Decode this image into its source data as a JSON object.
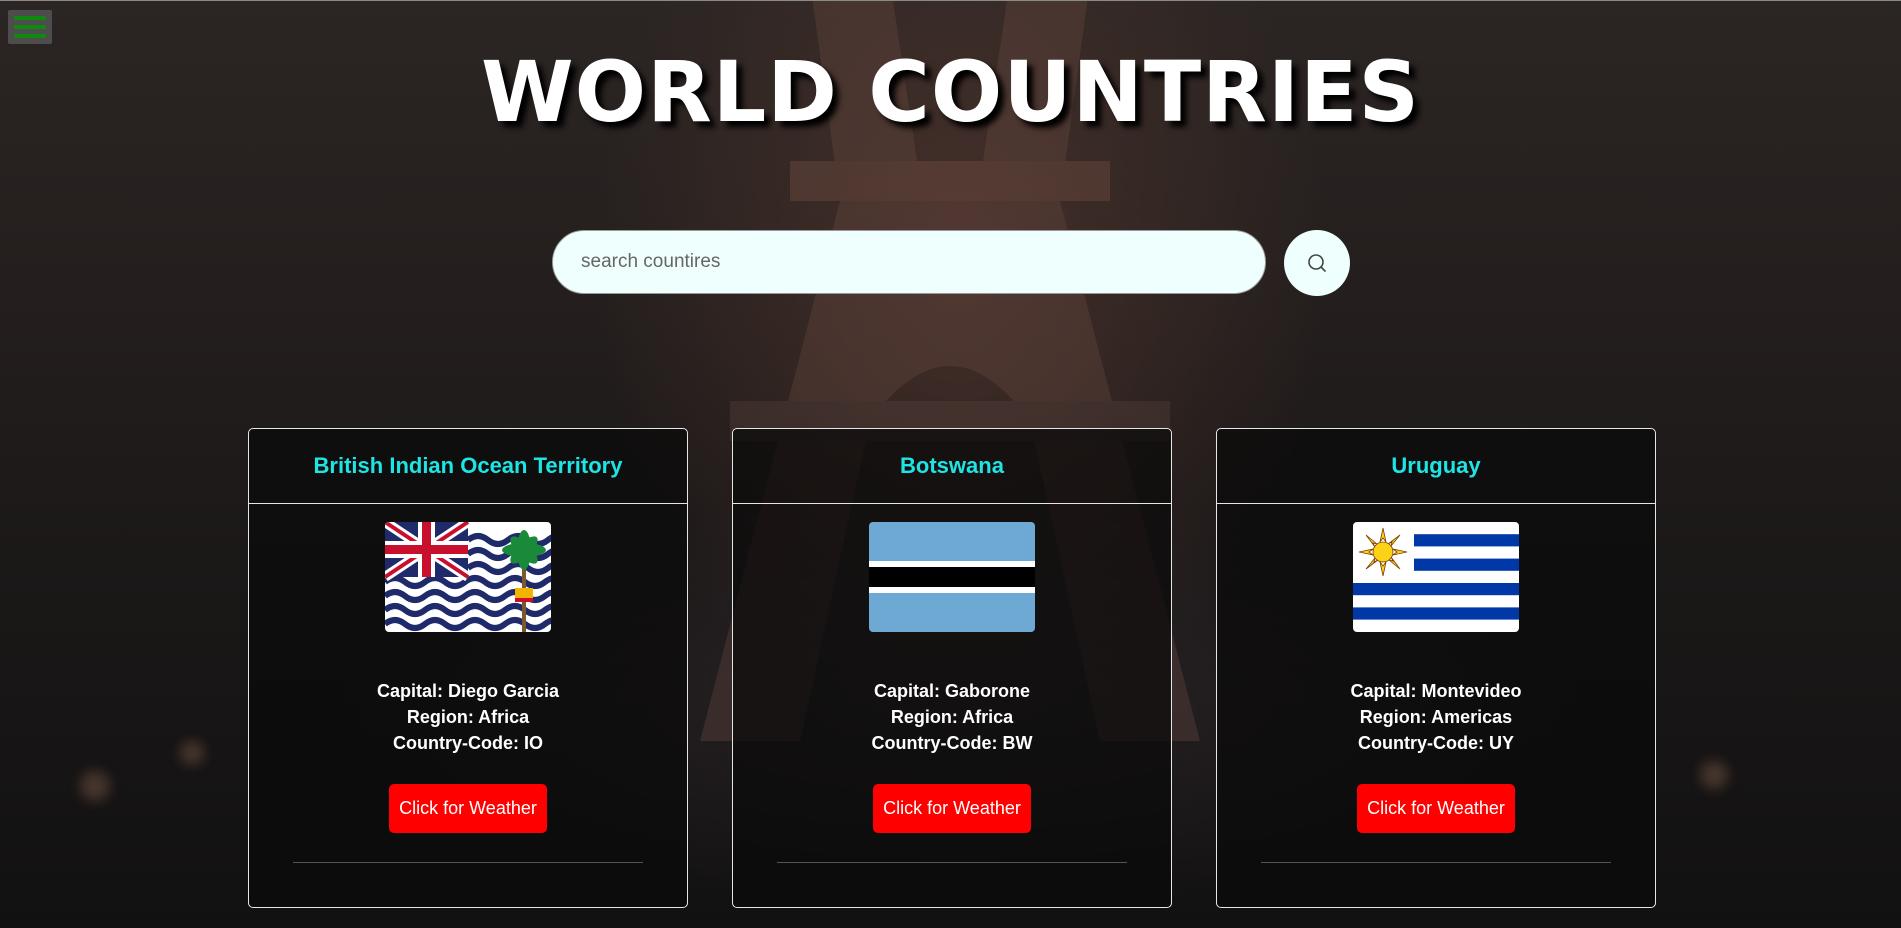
{
  "page": {
    "title": "WORLD COUNTRIES"
  },
  "menu": {
    "icon": "hamburger-menu-icon"
  },
  "search": {
    "placeholder": "search countires",
    "value": "",
    "button_icon": "search-icon"
  },
  "countries": [
    {
      "name": "British Indian Ocean Territory",
      "capital": "Capital: Diego Garcia",
      "region": "Region: Africa",
      "code": "Country-Code: IO",
      "button": "Click for Weather"
    },
    {
      "name": "Botswana",
      "capital": "Capital: Gaborone",
      "region": "Region: Africa",
      "code": "Country-Code: BW",
      "button": "Click for Weather"
    },
    {
      "name": "Uruguay",
      "capital": "Capital: Montevideo",
      "region": "Region: Americas",
      "code": "Country-Code: UY",
      "button": "Click for Weather"
    }
  ],
  "colors": {
    "title_text": "#ffffff",
    "card_title": "#1fe4e4",
    "weather_button": "#ff0000",
    "search_bg": "#eefffd",
    "menu_bar": "#0e8a0e"
  }
}
